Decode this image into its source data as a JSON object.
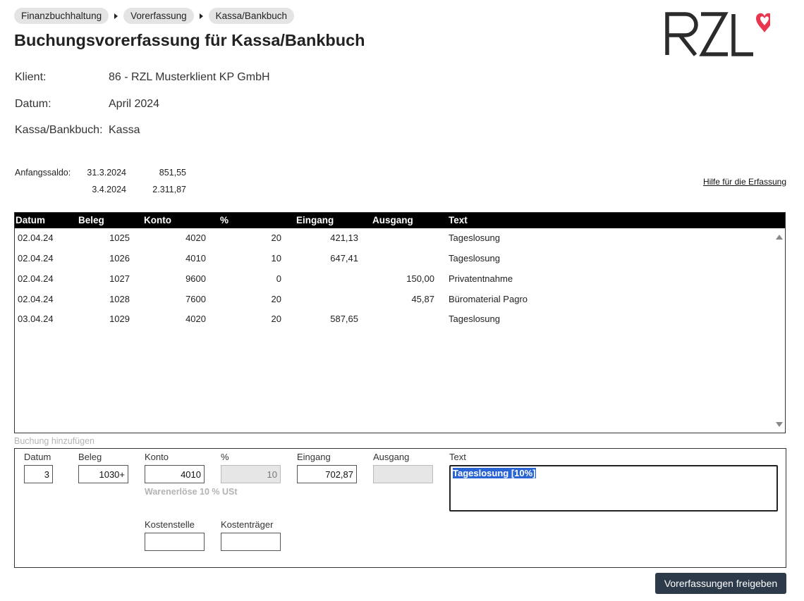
{
  "breadcrumb": [
    "Finanzbuchhaltung",
    "Vorerfassung",
    "Kassa/Bankbuch"
  ],
  "title": "Buchungsvorerfassung für Kassa/Bankbuch",
  "logo": {
    "text": "RZL",
    "icon": "heart-icon",
    "color": "#e8384f"
  },
  "info": {
    "klient_label": "Klient:",
    "klient_value": "86 - RZL Musterklient KP GmbH",
    "datum_label": "Datum:",
    "datum_value": "April 2024",
    "buch_label": "Kassa/Bankbuch:",
    "buch_value": "Kassa"
  },
  "saldo": {
    "label": "Anfangssaldo:",
    "rows": [
      {
        "date": "31.3.2024",
        "amount": "851,55"
      },
      {
        "date": "3.4.2024",
        "amount": "2.311,87"
      }
    ]
  },
  "help_link": "Hilfe für die Erfassung",
  "table": {
    "headers": [
      "Datum",
      "Beleg",
      "Konto",
      "%",
      "Eingang",
      "Ausgang",
      "Text"
    ],
    "rows": [
      {
        "datum": "02.04.24",
        "beleg": "1025",
        "konto": "4020",
        "pct": "20",
        "eingang": "421,13",
        "ausgang": "",
        "text": "Tageslosung"
      },
      {
        "datum": "02.04.24",
        "beleg": "1026",
        "konto": "4010",
        "pct": "10",
        "eingang": "647,41",
        "ausgang": "",
        "text": "Tageslosung"
      },
      {
        "datum": "02.04.24",
        "beleg": "1027",
        "konto": "9600",
        "pct": "0",
        "eingang": "",
        "ausgang": "150,00",
        "text": "Privatentnahme"
      },
      {
        "datum": "02.04.24",
        "beleg": "1028",
        "konto": "7600",
        "pct": "20",
        "eingang": "",
        "ausgang": "45,87",
        "text": "Büromaterial Pagro"
      },
      {
        "datum": "03.04.24",
        "beleg": "1029",
        "konto": "4020",
        "pct": "20",
        "eingang": "587,65",
        "ausgang": "",
        "text": "Tageslosung"
      }
    ]
  },
  "form": {
    "section_label": "Buchung hinzufügen",
    "labels": {
      "datum": "Datum",
      "beleg": "Beleg",
      "konto": "Konto",
      "pct": "%",
      "eingang": "Eingang",
      "ausgang": "Ausgang",
      "text": "Text",
      "kostenstelle": "Kostenstelle",
      "kostentraeger": "Kostenträger"
    },
    "values": {
      "datum": "3",
      "beleg": "1030+",
      "konto": "4010",
      "pct": "10",
      "eingang": "702,87",
      "ausgang": "",
      "text": "Tageslosung [10%]",
      "kostenstelle": "",
      "kostentraeger": ""
    },
    "konto_hint": "Warenerlöse 10 % USt"
  },
  "submit_label": "Vorerfassungen freigeben"
}
